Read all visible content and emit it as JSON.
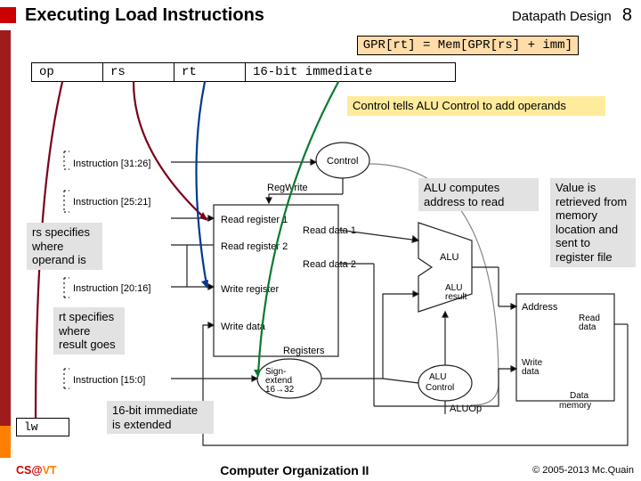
{
  "header": {
    "title": "Executing Load Instructions",
    "right": "Datapath Design",
    "page": "8"
  },
  "equation": "GPR[rt] = Mem[GPR[rs] + imm]",
  "instr": {
    "op": "op",
    "rs": "rs",
    "rt": "rt",
    "imm": "16-bit immediate"
  },
  "annots": {
    "control": "Control tells ALU Control to add operands",
    "alu": "ALU computes address to read",
    "retrieve": "Value is retrieved from memory location and sent to register file",
    "rs": "rs specifies where operand is",
    "rt": "rt specifies where result goes",
    "ext": "16-bit immediate is extended"
  },
  "lw": "lw",
  "diagram": {
    "bits3126": "Instruction [31:26]",
    "bits2521": "Instruction [25:21]",
    "bits2016": "Instruction [20:16]",
    "bits150": "Instruction [15:0]",
    "control": "Control",
    "regwrite": "RegWrite",
    "read1": "Read register 1",
    "read2": "Read register 2",
    "writereg": "Write register",
    "writedata": "Write data",
    "registers": "Registers",
    "readdata1": "Read data 1",
    "readdata2": "Read data 2",
    "alu": "ALU",
    "aluresult": "ALU result",
    "alucontrol": "ALU Control",
    "aluop": "ALUOp",
    "signext": "Sign-extend 16→32",
    "address": "Address",
    "dmreaddata": "Read data",
    "dmwritedata": "Write data",
    "datamem": "Data memory"
  },
  "footer": {
    "left_cs": "CS",
    "left_at": "@",
    "left_vt": "VT",
    "center": "Computer Organization II",
    "right": "© 2005-2013 Mc.Quain"
  }
}
